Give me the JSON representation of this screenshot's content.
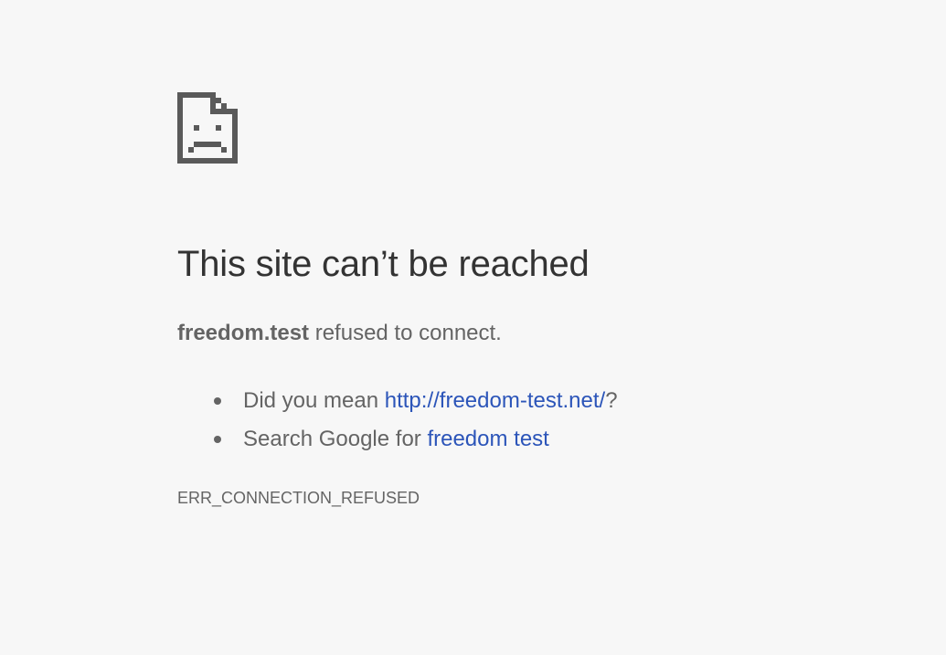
{
  "error_page": {
    "icon": "sad-document-icon",
    "title": "This site can’t be reached",
    "summary": {
      "host": "freedom.test",
      "message": " refused to connect."
    },
    "suggestions": [
      {
        "prefix": "Did you mean ",
        "link_text": "http://freedom-test.net/",
        "suffix": "?"
      },
      {
        "prefix": "Search Google for ",
        "link_text": "freedom test",
        "suffix": ""
      }
    ],
    "error_code": "ERR_CONNECTION_REFUSED"
  },
  "colors": {
    "background": "#f7f7f7",
    "title": "#333333",
    "body_text": "#646464",
    "link": "#2c55b9",
    "icon": "#5a5a5a"
  }
}
